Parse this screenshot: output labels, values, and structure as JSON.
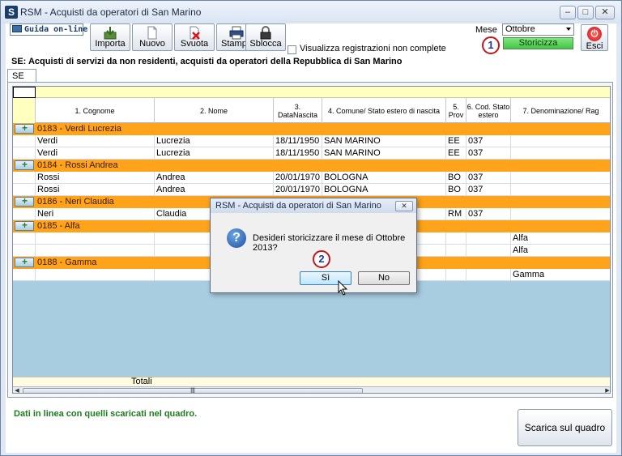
{
  "window": {
    "title": "RSM - Acquisti da operatori di San Marino",
    "app_icon": "S"
  },
  "toolbar": {
    "help_label": "Guida on-line",
    "buttons": [
      {
        "id": "importa",
        "label": "Importa",
        "icon": "import-icon"
      },
      {
        "id": "nuovo",
        "label": "Nuovo",
        "icon": "new-doc-icon"
      },
      {
        "id": "svuota",
        "label": "Svuota",
        "icon": "clear-icon"
      },
      {
        "id": "stampa",
        "label": "Stampa",
        "icon": "printer-icon"
      },
      {
        "id": "sblocca",
        "label": "Sblocca",
        "icon": "lock-icon"
      }
    ],
    "show_incomplete_label": "Visualizza registrazioni non complete",
    "mese_label": "Mese",
    "mese_value": "Ottobre",
    "storicizza_label": "Storicizza",
    "esci_label": "Esci"
  },
  "callouts": {
    "one": "1",
    "two": "2"
  },
  "section_title": "SE: Acquisti di servizi da non residenti, acquisti da operatori della Repubblica di San Marino",
  "tab_label": "SE",
  "grid": {
    "columns": [
      "1. Cognome",
      "2. Nome",
      "3. DataNascita",
      "4. Comune/ Stato estero di nascita",
      "5. Prov",
      "6. Cod. Stato estero",
      "7. Denominazione/ Rag"
    ],
    "groups": [
      {
        "title": "0183 - Verdi Lucrezia",
        "rows": [
          [
            "Verdi",
            "Lucrezia",
            "18/11/1950",
            "SAN MARINO",
            "EE",
            "037",
            ""
          ],
          [
            "Verdi",
            "Lucrezia",
            "18/11/1950",
            "SAN MARINO",
            "EE",
            "037",
            ""
          ]
        ]
      },
      {
        "title": "0184 - Rossi Andrea",
        "rows": [
          [
            "Rossi",
            "Andrea",
            "20/01/1970",
            "BOLOGNA",
            "BO",
            "037",
            ""
          ],
          [
            "Rossi",
            "Andrea",
            "20/01/1970",
            "BOLOGNA",
            "BO",
            "037",
            ""
          ]
        ]
      },
      {
        "title": "0186 - Neri Claudia",
        "rows": [
          [
            "Neri",
            "Claudia",
            "",
            "",
            "RM",
            "037",
            ""
          ]
        ]
      },
      {
        "title": "0185 - Alfa",
        "rows": [
          [
            "",
            "",
            "",
            "",
            "",
            "",
            "Alfa"
          ],
          [
            "",
            "",
            "",
            "",
            "",
            "",
            "Alfa"
          ]
        ]
      },
      {
        "title": "0188 - Gamma",
        "rows": [
          [
            "",
            "",
            "",
            "",
            "",
            "",
            "Gamma"
          ]
        ]
      }
    ],
    "totals_label": "Totali"
  },
  "status_text": "Dati in linea con quelli scaricati nel quadro.",
  "scarica_label": "Scarica sul quadro",
  "dialog": {
    "title": "RSM - Acquisti da operatori di San Marino",
    "message": "Desideri storicizzare il mese di Ottobre 2013?",
    "yes_label": "Sì",
    "no_label": "No"
  }
}
